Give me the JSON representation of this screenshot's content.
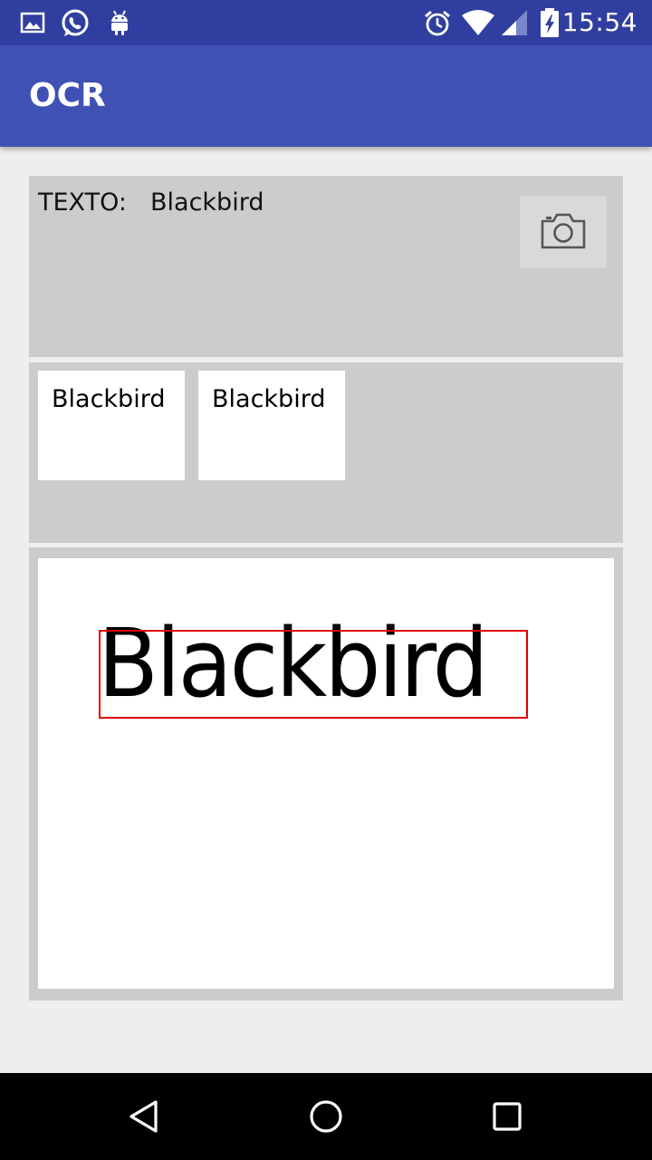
{
  "status_bar": {
    "time": "15:54",
    "left_icons": [
      "gallery-icon",
      "whatsapp-icon",
      "android-icon"
    ],
    "right_icons": [
      "alarm-icon",
      "wifi-icon",
      "signal-icon",
      "battery-charging-icon"
    ]
  },
  "app_bar": {
    "title": "OCR",
    "color": "#3f51b5",
    "status_color": "#303f9f"
  },
  "result": {
    "label": "TEXTO:",
    "value": "Blackbird",
    "camera_icon": "camera-icon"
  },
  "thumbnails": [
    {
      "text": "Blackbird"
    },
    {
      "text": "Blackbird"
    }
  ],
  "preview": {
    "word": "Blackbird",
    "box_color": "#e00000"
  },
  "nav_bar": {
    "icons": [
      "back-icon",
      "home-icon",
      "recent-apps-icon"
    ]
  }
}
